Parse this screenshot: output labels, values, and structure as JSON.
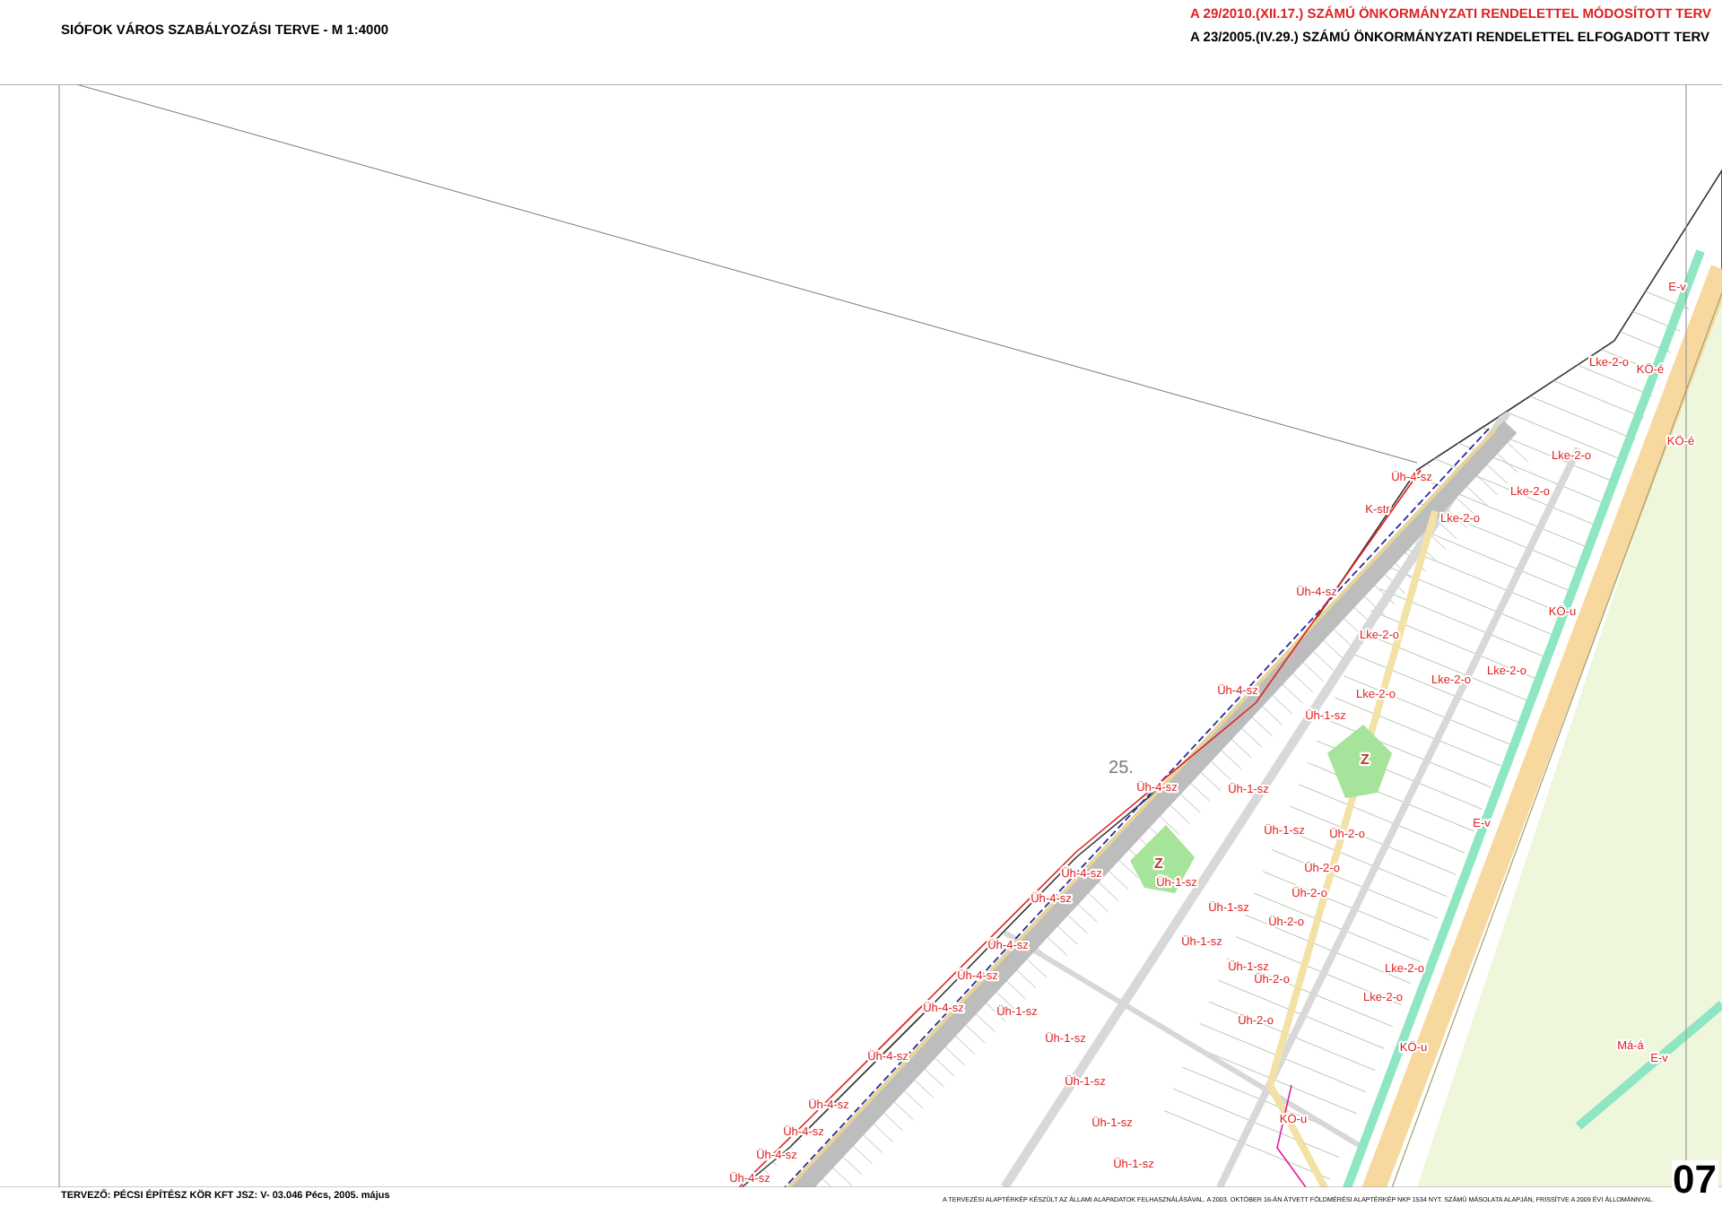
{
  "header": {
    "title": "SIÓFOK VÁROS SZABÁLYOZÁSI TERVE  -  M 1:4000",
    "amendment": "A 29/2010.(XII.17.) SZÁMÚ ÖNKORMÁNYZATI RENDELETTEL MÓDOSÍTOTT TERV",
    "approval": "A 23/2005.(IV.29.) SZÁMÚ ÖNKORMÁNYZATI RENDELETTEL ELFOGADOTT TERV"
  },
  "map": {
    "labels": [
      {
        "text": "E-v",
        "kind": "zone"
      },
      {
        "text": "Lke-2-o",
        "kind": "zone"
      },
      {
        "text": "KÖ-é",
        "kind": "zone"
      },
      {
        "text": "Lke-2-o",
        "kind": "zone"
      },
      {
        "text": "KÖ-é",
        "kind": "zone"
      },
      {
        "text": "Üh-4-sz",
        "kind": "zone"
      },
      {
        "text": "K-str",
        "kind": "zone"
      },
      {
        "text": "Lke-2-o",
        "kind": "zone"
      },
      {
        "text": "Lke-2-o",
        "kind": "zone"
      },
      {
        "text": "Üh-4-sz",
        "kind": "zone"
      },
      {
        "text": "KÖ-u",
        "kind": "zone"
      },
      {
        "text": "Lke-2-o",
        "kind": "zone"
      },
      {
        "text": "Lke-2-o",
        "kind": "zone"
      },
      {
        "text": "Lke-2-o",
        "kind": "zone"
      },
      {
        "text": "Lke-2-o",
        "kind": "zone"
      },
      {
        "text": "Üh-4-sz",
        "kind": "zone"
      },
      {
        "text": "Üh-1-sz",
        "kind": "zone"
      },
      {
        "text": "Z",
        "kind": "park"
      },
      {
        "text": "25.",
        "kind": "sheet"
      },
      {
        "text": "Üh-4-sz",
        "kind": "zone"
      },
      {
        "text": "Üh-1-sz",
        "kind": "zone"
      },
      {
        "text": "E-v",
        "kind": "zone"
      },
      {
        "text": "Üh-1-sz",
        "kind": "zone"
      },
      {
        "text": "Üh-2-o",
        "kind": "zone"
      },
      {
        "text": "Z",
        "kind": "park"
      },
      {
        "text": "Üh-2-o",
        "kind": "zone"
      },
      {
        "text": "Üh-4-sz",
        "kind": "zone"
      },
      {
        "text": "Üh-1-sz",
        "kind": "zone"
      },
      {
        "text": "Üh-2-o",
        "kind": "zone"
      },
      {
        "text": "Üh-4-sz",
        "kind": "zone"
      },
      {
        "text": "Üh-1-sz",
        "kind": "zone"
      },
      {
        "text": "Üh-2-o",
        "kind": "zone"
      },
      {
        "text": "Üh-4-sz",
        "kind": "zone"
      },
      {
        "text": "Üh-1-sz",
        "kind": "zone"
      },
      {
        "text": "Üh-1-sz",
        "kind": "zone"
      },
      {
        "text": "Üh-2-o",
        "kind": "zone"
      },
      {
        "text": "Üh-4-sz",
        "kind": "zone"
      },
      {
        "text": "Üh-1-sz",
        "kind": "zone"
      },
      {
        "text": "Lke-2-o",
        "kind": "zone"
      },
      {
        "text": "Lke-2-o",
        "kind": "zone"
      },
      {
        "text": "Üh-4-sz",
        "kind": "zone"
      },
      {
        "text": "Üh-1-sz",
        "kind": "zone"
      },
      {
        "text": "Üh-2-o",
        "kind": "zone"
      },
      {
        "text": "KÖ-u",
        "kind": "zone"
      },
      {
        "text": "Má-á",
        "kind": "zone"
      },
      {
        "text": "E-v",
        "kind": "zone"
      },
      {
        "text": "Üh-4-sz",
        "kind": "zone"
      },
      {
        "text": "Üh-1-sz",
        "kind": "zone"
      },
      {
        "text": "Üh-4-sz",
        "kind": "zone"
      },
      {
        "text": "Üh-1-sz",
        "kind": "zone"
      },
      {
        "text": "Üh-4-sz",
        "kind": "zone"
      },
      {
        "text": "KÖ-u",
        "kind": "zone"
      },
      {
        "text": "Üh-1-sz",
        "kind": "zone"
      },
      {
        "text": "Üh-4-sz",
        "kind": "zone"
      },
      {
        "text": "Üh-4-sz",
        "kind": "zone"
      }
    ]
  },
  "footer": {
    "designer": "TERVEZŐ: PÉCSI ÉPÍTÉSZ KÖR KFT  JSZ: V- 03.046  Pécs, 2005. május",
    "basemap_note": "A TERVEZÉSI ALAPTÉRKÉP KÉSZÜLT AZ ÁLLAMI ALAPADATOK FELHASZNÁLÁSÁVAL. A 2003. OKTÓBER 16-ÁN ÁTVETT FÖLDMÉRÉSI ALAPTÉRKÉP NKP 1534 NYT. SZÁMÚ MÁSOLATA ALAPJÁN, FRISSÍTVE A 2009 ÉVI ÁLLOMÁNNYAL.",
    "sheet_number": "07"
  }
}
